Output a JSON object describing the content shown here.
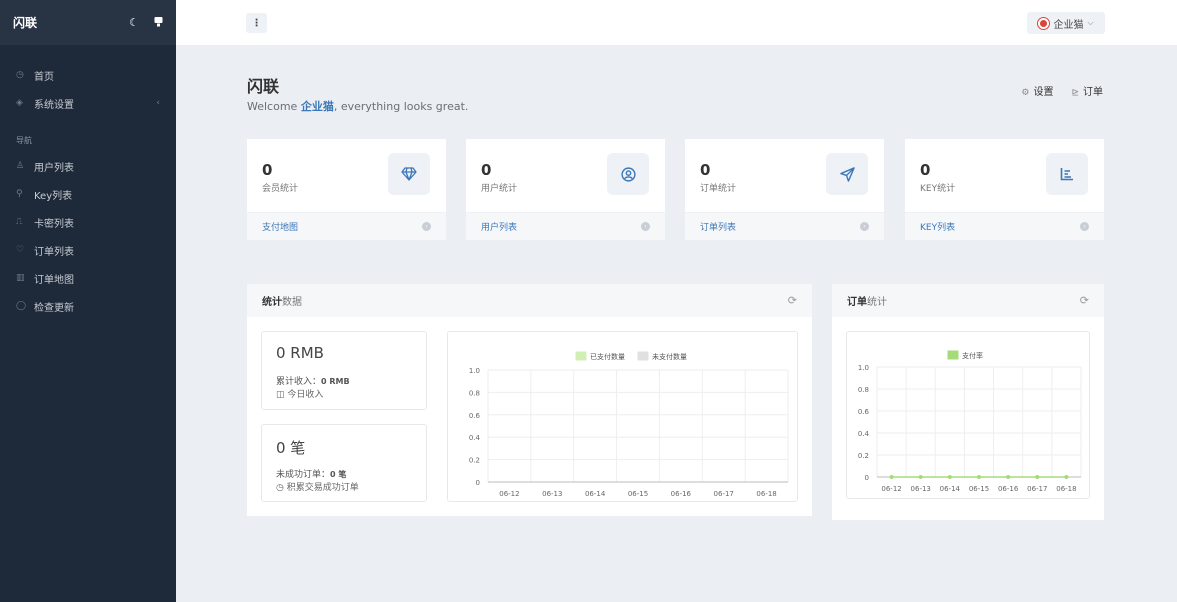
{
  "sidebar": {
    "brand": "闪联",
    "moon_icon": "☾",
    "bulb_icon": "💡",
    "items_top": [
      {
        "icon": "◷",
        "label": "首页"
      },
      {
        "icon": "◈",
        "label": "系统设置",
        "chevron": "‹"
      }
    ],
    "section_label": "导航",
    "items": [
      {
        "icon": "♙",
        "label": "用户列表"
      },
      {
        "icon": "⚲",
        "label": "Key列表"
      },
      {
        "icon": "⎍",
        "label": "卡密列表"
      },
      {
        "icon": "♡",
        "label": "订单列表"
      },
      {
        "icon": "▥",
        "label": "订单地图"
      },
      {
        "icon": "◯",
        "label": "检查更新"
      }
    ]
  },
  "header": {
    "menu_icon": "⋮",
    "username": "企业猫",
    "caret": "⌵"
  },
  "page": {
    "title": "闪联",
    "welcome_prefix": "Welcome ",
    "welcome_name": "企业猫",
    "welcome_suffix": ", everything looks great.",
    "actions": [
      {
        "icon": "⚙",
        "label": "设置"
      },
      {
        "icon": "⊵",
        "label": "订单"
      }
    ]
  },
  "stats": [
    {
      "value": "0",
      "label": "会员统计",
      "icon": "♦",
      "link": "支付地图"
    },
    {
      "value": "0",
      "label": "用户统计",
      "icon": "◉",
      "link": "用户列表"
    },
    {
      "value": "0",
      "label": "订单统计",
      "icon": "➤",
      "link": "订单列表"
    },
    {
      "value": "0",
      "label": "KEY统计",
      "icon": "☰",
      "link": "KEY列表"
    }
  ],
  "panel_left": {
    "title_bold": "统计",
    "title_thin": "数据",
    "refresh_icon": "⟳",
    "income": {
      "amount": "0 RMB",
      "line1_label": "累计收入：",
      "line1_value": "0 RMB",
      "line2_icon": "◫",
      "line2": "今日收入"
    },
    "orders": {
      "amount": "0 笔",
      "line1_label": "未成功订单：",
      "line1_value": "0 笔",
      "line2_icon": "◷",
      "line2": "积累交易成功订单"
    }
  },
  "panel_right": {
    "title_bold": "订单",
    "title_thin": "统计",
    "refresh_icon": "⟳"
  },
  "colors": {
    "sidebar_bg": "#1e2939",
    "accent": "#3c77b8",
    "paid_series": "#d1eeb4",
    "unpaid_series": "#e0e0e0",
    "rate_series": "#a6db7a"
  },
  "chart_data": [
    {
      "type": "bar",
      "categories": [
        "06-12",
        "06-13",
        "06-14",
        "06-15",
        "06-16",
        "06-17",
        "06-18"
      ],
      "series": [
        {
          "name": "已支付数量",
          "values": [
            0,
            0,
            0,
            0,
            0,
            0,
            0
          ]
        },
        {
          "name": "未支付数量",
          "values": [
            0,
            0,
            0,
            0,
            0,
            0,
            0
          ]
        }
      ],
      "y_ticks": [
        "0",
        "0.2",
        "0.4",
        "0.6",
        "0.8",
        "1.0"
      ],
      "ylim": [
        0,
        1.0
      ],
      "grid": true,
      "legend": "top-center"
    },
    {
      "type": "line",
      "categories": [
        "06-12",
        "06-13",
        "06-14",
        "06-15",
        "06-16",
        "06-17",
        "06-18"
      ],
      "series": [
        {
          "name": "支付率",
          "values": [
            0,
            0,
            0,
            0,
            0,
            0,
            0
          ]
        }
      ],
      "y_ticks": [
        "0",
        "0.2",
        "0.4",
        "0.6",
        "0.8",
        "1.0"
      ],
      "ylim": [
        0,
        1.0
      ],
      "grid": true,
      "legend": "top-center"
    }
  ]
}
